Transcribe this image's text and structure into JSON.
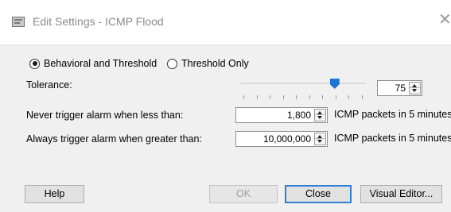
{
  "window": {
    "title": "Edit Settings - ICMP Flood",
    "close_glyph": "✕"
  },
  "mode": {
    "options": [
      {
        "label": "Behavioral and Threshold",
        "selected": true
      },
      {
        "label": "Threshold Only",
        "selected": false
      }
    ]
  },
  "tolerance": {
    "label": "Tolerance:",
    "value": "75",
    "slider_fraction": 0.75
  },
  "never_trigger": {
    "label": "Never trigger alarm when less than:",
    "value": "1,800",
    "unit": "ICMP packets in 5 minutes"
  },
  "always_trigger": {
    "label": "Always trigger alarm when greater than:",
    "value": "10,000,000",
    "unit": "ICMP packets in 5 minutes"
  },
  "buttons": {
    "help": "Help",
    "ok": "OK",
    "close": "Close",
    "visual_editor": "Visual Editor..."
  },
  "colors": {
    "slider_thumb": "#1e74d6",
    "primary_border": "#2f7fd4"
  }
}
